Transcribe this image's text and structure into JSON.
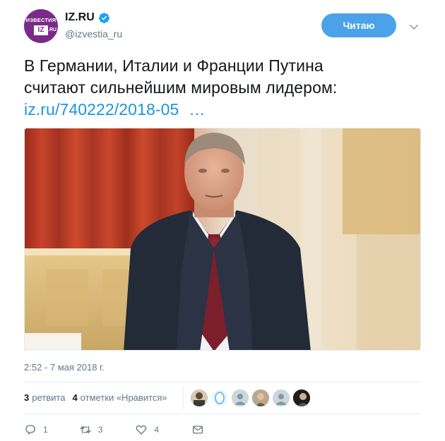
{
  "header": {
    "avatar_logo_top": "ИЗВЕСТИЯ",
    "avatar_logo_box": "IZ",
    "avatar_logo_ru": ".RU",
    "display_name": "IZ.RU",
    "handle": "@izvestia_ru",
    "follow_label": "Читаю",
    "verified_icon": "verified-badge-icon",
    "caret_icon": "chevron-down-icon"
  },
  "tweet": {
    "text_line1": "В Германии, Италии и Франции Путина",
    "text_line2": "считают сильнейшим мировым лидером:",
    "link": "iz.ru/740222/2018-05",
    "ellipsis": "…",
    "timestamp": "2:52 - 7 мая 2018 г."
  },
  "stats": {
    "retweets_count": "3",
    "retweets_label": "ретвита",
    "likes_count": "4",
    "likes_label": "отметки «Нравится»"
  },
  "actions": {
    "reply_count": "1",
    "retweet_count": "3",
    "like_count": "4",
    "reply_icon": "reply-icon",
    "retweet_icon": "retweet-icon",
    "like_icon": "heart-icon",
    "message_icon": "envelope-icon"
  },
  "colors": {
    "accent": "#1b95e0",
    "follow_button": "#4aa3e8",
    "muted": "#657786",
    "brand": "#7b2a8a"
  }
}
